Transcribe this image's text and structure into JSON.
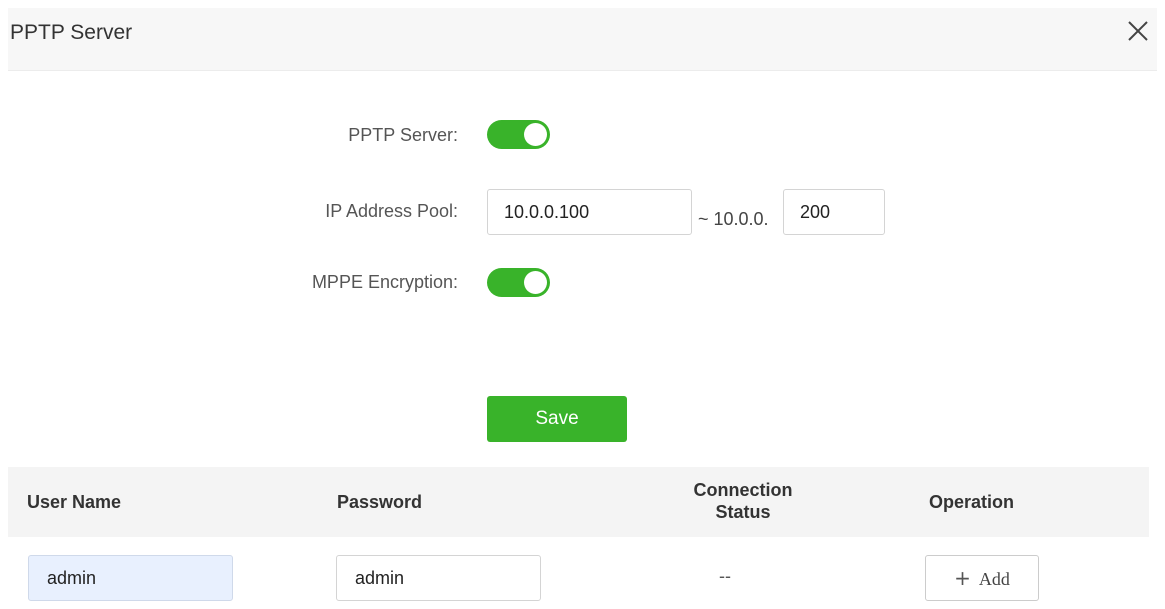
{
  "dialog": {
    "title": "PPTP Server",
    "close_icon": "close-icon"
  },
  "form": {
    "pptp_server": {
      "label": "PPTP Server:",
      "enabled": true
    },
    "ip_pool": {
      "label": "IP Address Pool:",
      "start": "10.0.0.100",
      "separator": "~ 10.0.0.",
      "end": "200"
    },
    "mppe": {
      "label": "MPPE Encryption:",
      "enabled": true
    },
    "save_label": "Save"
  },
  "table": {
    "headers": {
      "user_name": "User Name",
      "password": "Password",
      "status_line1": "Connection",
      "status_line2": "Status",
      "operation": "Operation"
    },
    "row": {
      "user_name": "admin",
      "password": "admin",
      "status": "--",
      "add_label": "Add",
      "add_icon": "plus-icon"
    }
  },
  "colors": {
    "accent": "#39b32a",
    "header_bg": "#f7f7f7",
    "table_header_bg": "#f4f4f4",
    "autofill_bg": "#e8f0fe"
  }
}
